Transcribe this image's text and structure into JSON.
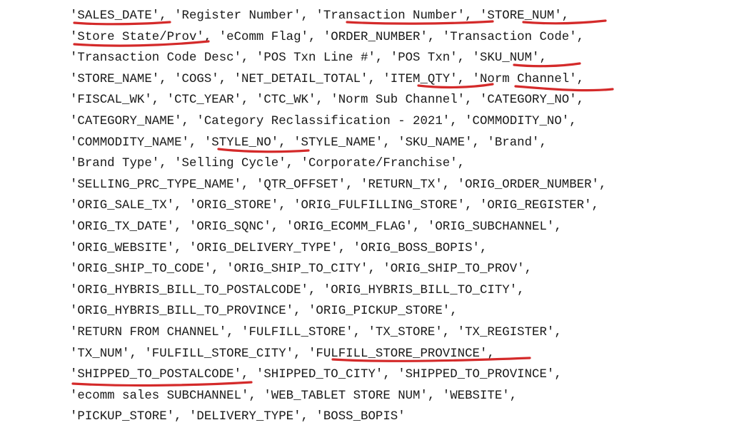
{
  "code": {
    "lines": [
      "'SALES_DATE', 'Register Number', 'Transaction Number', 'STORE_NUM',",
      "'Store State/Prov', 'eComm Flag', 'ORDER_NUMBER', 'Transaction Code',",
      "'Transaction Code Desc', 'POS Txn Line #', 'POS Txn', 'SKU_NUM',",
      "'STORE_NAME', 'COGS', 'NET_DETAIL_TOTAL', 'ITEM_QTY', 'Norm Channel',",
      "'FISCAL_WK', 'CTC_YEAR', 'CTC_WK', 'Norm Sub Channel', 'CATEGORY_NO',",
      "'CATEGORY_NAME', 'Category Reclassification - 2021', 'COMMODITY_NO',",
      "'COMMODITY_NAME', 'STYLE_NO', 'STYLE_NAME', 'SKU_NAME', 'Brand',",
      "'Brand Type', 'Selling Cycle', 'Corporate/Franchise',",
      "'SELLING_PRC_TYPE_NAME', 'QTR_OFFSET', 'RETURN_TX', 'ORIG_ORDER_NUMBER',",
      "'ORIG_SALE_TX', 'ORIG_STORE', 'ORIG_FULFILLING_STORE', 'ORIG_REGISTER',",
      "'ORIG_TX_DATE', 'ORIG_SQNC', 'ORIG_ECOMM_FLAG', 'ORIG_SUBCHANNEL',",
      "'ORIG_WEBSITE', 'ORIG_DELIVERY_TYPE', 'ORIG_BOSS_BOPIS',",
      "'ORIG_SHIP_TO_CODE', 'ORIG_SHIP_TO_CITY', 'ORIG_SHIP_TO_PROV',",
      "'ORIG_HYBRIS_BILL_TO_POSTALCODE', 'ORIG_HYBRIS_BILL_TO_CITY',",
      "'ORIG_HYBRIS_BILL_TO_PROVINCE', 'ORIG_PICKUP_STORE',",
      "'RETURN FROM CHANNEL', 'FULFILL_STORE', 'TX_STORE', 'TX_REGISTER',",
      "'TX_NUM', 'FULFILL_STORE_CITY', 'FULFILL_STORE_PROVINCE',",
      "'SHIPPED_TO_POSTALCODE', 'SHIPPED_TO_CITY', 'SHIPPED_TO_PROVINCE',",
      "'ecomm sales SUBCHANNEL', 'WEB_TABLET STORE NUM', 'WEBSITE',",
      "'PICKUP_STORE', 'DELIVERY_TYPE', 'BOSS_BOPIS'"
    ]
  },
  "annotations": {
    "color": "#d42a2a",
    "underlined": [
      "SALES_DATE",
      "Transaction Number",
      "STORE_NUM",
      "Store State/Prov",
      "SKU_NUM",
      "ITEM_QTY",
      "Norm Channel",
      "STYLE_NO",
      "FULFILL_STORE_PROVINCE",
      "SHIPPED_TO_POSTALCODE"
    ]
  }
}
